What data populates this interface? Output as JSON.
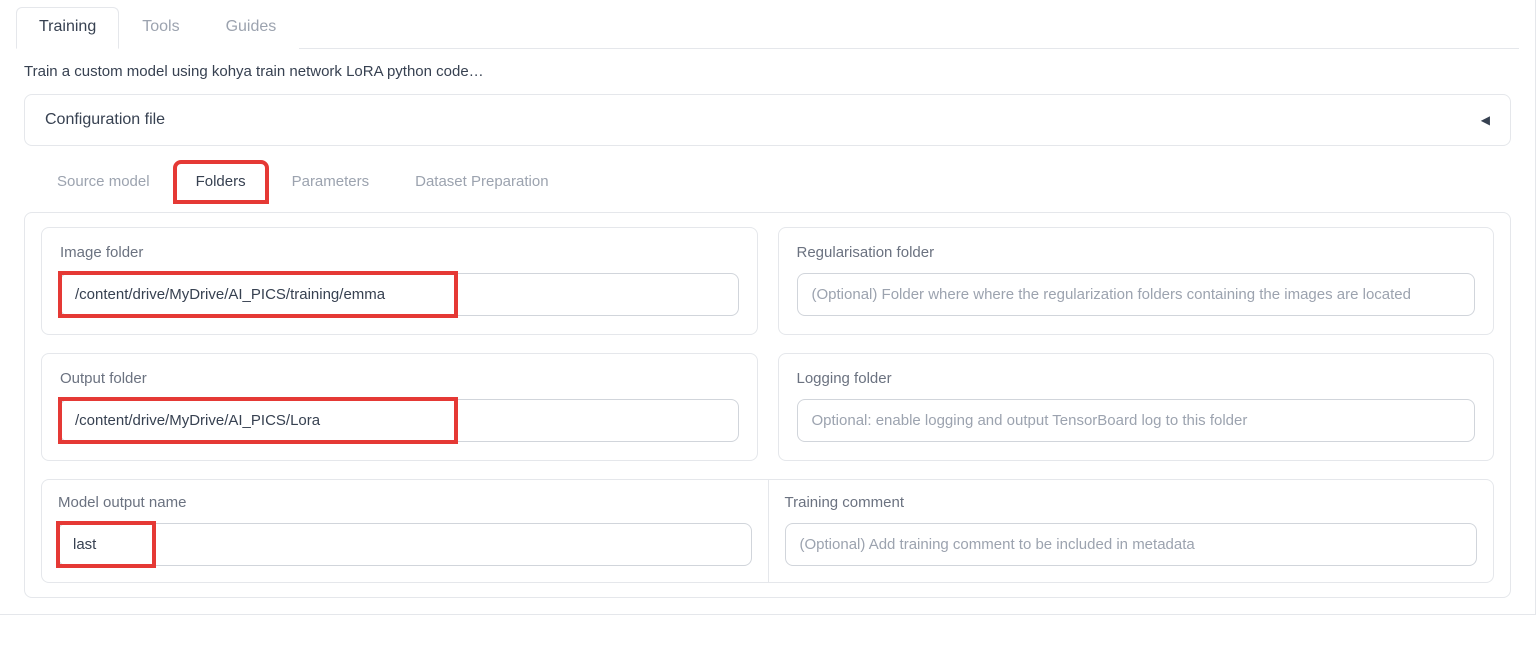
{
  "topTabs": {
    "training": "Training",
    "tools": "Tools",
    "guides": "Guides"
  },
  "description": "Train a custom model using kohya train network LoRA python code…",
  "accordion": {
    "title": "Configuration file"
  },
  "innerTabs": {
    "sourceModel": "Source model",
    "folders": "Folders",
    "parameters": "Parameters",
    "datasetPrep": "Dataset Preparation"
  },
  "fields": {
    "imageFolder": {
      "label": "Image folder",
      "value": "/content/drive/MyDrive/AI_PICS/training/emma"
    },
    "regFolder": {
      "label": "Regularisation folder",
      "placeholder": "(Optional) Folder where where the regularization folders containing the images are located"
    },
    "outputFolder": {
      "label": "Output folder",
      "value": "/content/drive/MyDrive/AI_PICS/Lora"
    },
    "loggingFolder": {
      "label": "Logging folder",
      "placeholder": "Optional: enable logging and output TensorBoard log to this folder"
    },
    "modelOutputName": {
      "label": "Model output name",
      "value": "last"
    },
    "trainingComment": {
      "label": "Training comment",
      "placeholder": "(Optional) Add training comment to be included in metadata"
    }
  }
}
